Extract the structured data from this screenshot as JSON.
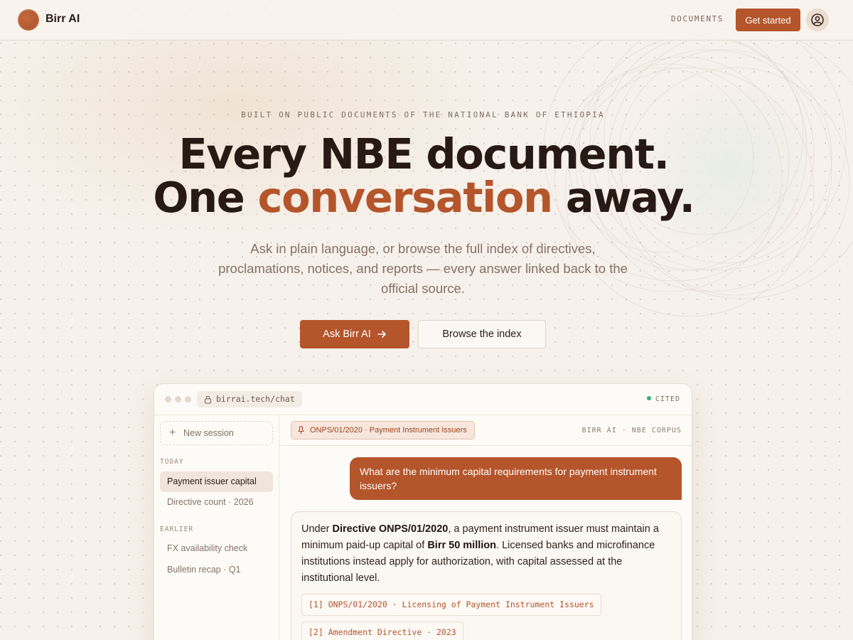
{
  "nav": {
    "brand": "Birr AI",
    "documents_link": "DOCUMENTS",
    "cta_label": "Get started",
    "avatar_icon": "user-circle-icon"
  },
  "hero": {
    "eyebrow": "BUILT ON PUBLIC DOCUMENTS OF THE NATIONAL BANK OF ETHIOPIA",
    "headline_line1": "Every NBE document.",
    "headline_line2_pre": "One ",
    "headline_line2_accent": "conversation",
    "headline_line2_post": " away.",
    "subtext": "Ask in plain language, or browse the full index of directives, proclamations, notices, and reports — every answer linked back to the official source.",
    "primary_button": "Ask Birr AI",
    "secondary_button": "Browse the index"
  },
  "app": {
    "url": "birrai.tech/chat",
    "status": "CITED",
    "sidebar": {
      "new_session": "New session",
      "today_label": "TODAY",
      "today_items": [
        "Payment issuer capital",
        "Directive count · 2026"
      ],
      "earlier_label": "EARLIER",
      "earlier_items": [
        "FX availability check",
        "Bulletin recap · Q1"
      ]
    },
    "chat": {
      "document_chip": "ONPS/01/2020 · Payment Instrument Issuers",
      "corpus_label": "BIRR AI · NBE CORPUS",
      "user_message": "What are the minimum capital requirements for payment instrument issuers?",
      "answer": {
        "t1": "Under ",
        "b1": "Directive ONPS/01/2020",
        "t2": ", a payment instrument issuer must maintain a minimum paid-up capital of ",
        "b2": "Birr 50 million",
        "t3": ". Licensed banks and microfinance institutions instead apply for authorization, with capital assessed at the institutional level."
      },
      "citations": [
        "[1] ONPS/01/2020 · Licensing of Payment Instrument Issuers",
        "[2] Amendment Directive · 2023"
      ]
    }
  },
  "colors": {
    "accent": "#b4552b",
    "background": "#f6f1ea",
    "status_green": "#2fb27a"
  }
}
